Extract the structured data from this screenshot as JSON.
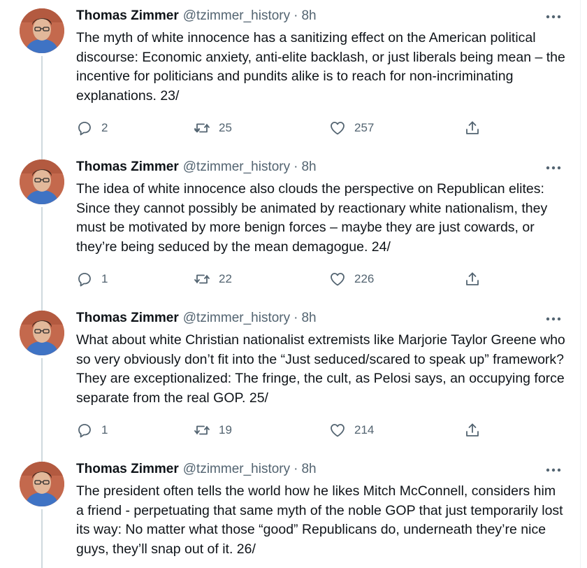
{
  "author": {
    "name": "Thomas Zimmer",
    "handle": "@tzimmer_history",
    "separator": "·"
  },
  "tweets": [
    {
      "time": "8h",
      "text": "The myth of white innocence has a sanitizing effect on the American political discourse: Economic anxiety, anti-elite backlash, or just liberals being mean – the incentive for politicians and pundits alike is to reach for non-incriminating explanations. 23/",
      "replies": "2",
      "retweets": "25",
      "likes": "257"
    },
    {
      "time": "8h",
      "text": "The idea of white innocence also clouds the perspective on Republican elites: Since they cannot possibly be animated by reactionary white nationalism, they must be motivated by more benign forces – maybe they are just cowards, or they’re being seduced by the mean demagogue. 24/",
      "replies": "1",
      "retweets": "22",
      "likes": "226"
    },
    {
      "time": "8h",
      "text": "What about white Christian nationalist extremists like Marjorie Taylor Greene who so very obviously don’t fit into the “Just seduced/scared to speak up” framework? They are exceptionalized: The fringe, the cult, as Pelosi says, an occupying force separate from the real GOP. 25/",
      "replies": "1",
      "retweets": "19",
      "likes": "214"
    },
    {
      "time": "8h",
      "text": "The president often tells the world how he likes Mitch McConnell, considers him a friend - perpetuating that same myth of the noble GOP that just temporarily lost its way: No matter what those “good” Republicans do, underneath they’re nice guys, they’ll snap out of it. 26/"
    }
  ],
  "icons": {
    "more": "more-horizontal-icon",
    "reply": "reply-icon",
    "retweet": "retweet-icon",
    "like": "heart-icon",
    "share": "share-icon"
  },
  "colors": {
    "text": "#0f1419",
    "secondary": "#536471",
    "thread_line": "#cfd9de"
  }
}
